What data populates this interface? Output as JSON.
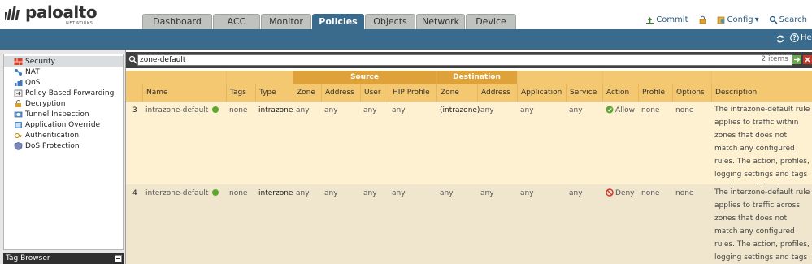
{
  "brand": {
    "name": "paloalto",
    "sub": "NETWORKS"
  },
  "tabs": [
    "Dashboard",
    "ACC",
    "Monitor",
    "Policies",
    "Objects",
    "Network",
    "Device"
  ],
  "header_actions": {
    "commit": "Commit",
    "config": "Config",
    "search": "Search"
  },
  "help_label": "Help",
  "sidebar": {
    "items": [
      "Security",
      "NAT",
      "QoS",
      "Policy Based Forwarding",
      "Decryption",
      "Tunnel Inspection",
      "Application Override",
      "Authentication",
      "DoS Protection"
    ],
    "tag_browser": "Tag Browser"
  },
  "filter": {
    "value": "zone-default",
    "count": "2 items"
  },
  "table": {
    "groups": {
      "source": "Source",
      "destination": "Destination"
    },
    "columns": {
      "num": "",
      "name": "Name",
      "tags": "Tags",
      "type": "Type",
      "src_zone": "Zone",
      "src_address": "Address",
      "src_user": "User",
      "src_hip": "HIP Profile",
      "dst_zone": "Zone",
      "dst_address": "Address",
      "application": "Application",
      "service": "Service",
      "action": "Action",
      "profile": "Profile",
      "options": "Options",
      "description": "Description"
    },
    "rows": [
      {
        "num": "3",
        "name": "intrazone-default",
        "tags": "none",
        "type": "intrazone",
        "src_zone": "any",
        "src_address": "any",
        "src_user": "any",
        "src_hip": "any",
        "dst_zone": "(intrazone)",
        "dst_address": "any",
        "application": "any",
        "service": "any",
        "action": "Allow",
        "profile": "none",
        "options": "none",
        "description": "The intrazone-default rule applies to traffic within zones that does not match any configured rules. The action, profiles, logging settings and tags may be modified."
      },
      {
        "num": "4",
        "name": "interzone-default",
        "tags": "none",
        "type": "interzone",
        "src_zone": "any",
        "src_address": "any",
        "src_user": "any",
        "src_hip": "any",
        "dst_zone": "any",
        "dst_address": "any",
        "application": "any",
        "service": "any",
        "action": "Deny",
        "profile": "none",
        "options": "none",
        "description": "The interzone-default rule applies to traffic across zones that does not match any configured rules. The action, profiles, logging settings and tags may be modified."
      }
    ]
  },
  "colors": {
    "accent": "#3a6b8c",
    "header": "#f4c771",
    "group_header": "#dfa23b",
    "row_odd": "#fdf1d2",
    "row_even": "#efe6cd",
    "allow": "#5aa82e",
    "deny": "#d9312b"
  }
}
